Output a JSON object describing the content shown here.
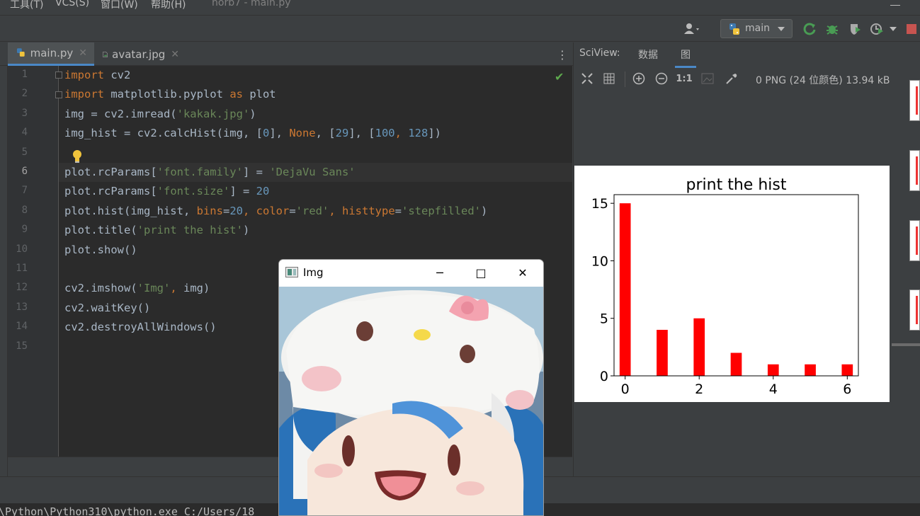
{
  "menubar": {
    "items": [
      "工具(T)",
      "VCS(S)",
      "窗口(W)",
      "帮助(H)"
    ],
    "title": "horb7 - main.py"
  },
  "toolbar": {
    "run_config": "main",
    "icons": [
      "user-icon",
      "python-icon",
      "rerun-icon",
      "debug-icon",
      "coverage-icon",
      "profile-icon",
      "stop-icon"
    ]
  },
  "editor": {
    "tabs": [
      {
        "label": "main.py",
        "icon": "python-file-icon",
        "active": true
      },
      {
        "label": "avatar.jpg",
        "icon": "image-file-icon",
        "active": false
      }
    ],
    "current_line": 6,
    "lines": [
      [
        [
          "kw",
          "import"
        ],
        [
          "pl",
          " cv2"
        ]
      ],
      [
        [
          "kw",
          "import"
        ],
        [
          "pl",
          " matplotlib.pyplot "
        ],
        [
          "kw",
          "as"
        ],
        [
          "pl",
          " plot"
        ]
      ],
      [
        [
          "pl",
          "img = cv2.imread("
        ],
        [
          "str",
          "'kakak.jpg'"
        ],
        [
          "pl",
          ")"
        ]
      ],
      [
        [
          "pl",
          "img_hist = cv2.calcHist(img, ["
        ],
        [
          "num",
          "0"
        ],
        [
          "pl",
          "], "
        ],
        [
          "kw",
          "None"
        ],
        [
          "pl",
          ", ["
        ],
        [
          "num",
          "29"
        ],
        [
          "pl",
          "], ["
        ],
        [
          "num",
          "100"
        ],
        [
          "kw",
          ", "
        ],
        [
          "num",
          "128"
        ],
        [
          "pl",
          "])"
        ]
      ],
      [],
      [
        [
          "pl",
          "plot.rcParams["
        ],
        [
          "str",
          "'font.family'"
        ],
        [
          "pl",
          "] = "
        ],
        [
          "str",
          "'DejaVu Sans'"
        ]
      ],
      [
        [
          "pl",
          "plot.rcParams["
        ],
        [
          "str",
          "'font.size'"
        ],
        [
          "pl",
          "] = "
        ],
        [
          "num",
          "20"
        ]
      ],
      [
        [
          "pl",
          "plot.hist(img_hist, "
        ],
        [
          "kw",
          "bins"
        ],
        [
          "pl",
          "="
        ],
        [
          "num",
          "20"
        ],
        [
          "kw",
          ", "
        ],
        [
          "kw",
          "color"
        ],
        [
          "pl",
          "="
        ],
        [
          "str",
          "'red'"
        ],
        [
          "kw",
          ", "
        ],
        [
          "kw",
          "histtype"
        ],
        [
          "pl",
          "="
        ],
        [
          "str",
          "'stepfilled'"
        ],
        [
          "pl",
          ")"
        ]
      ],
      [
        [
          "pl",
          "plot.title("
        ],
        [
          "str",
          "'print the hist'"
        ],
        [
          "pl",
          ")"
        ]
      ],
      [
        [
          "pl",
          "plot.show()"
        ]
      ],
      [],
      [
        [
          "pl",
          "cv2.imshow("
        ],
        [
          "str",
          "'Img'"
        ],
        [
          "kw",
          ", "
        ],
        [
          "pl",
          "img)"
        ]
      ],
      [
        [
          "pl",
          "cv2.waitKey()"
        ]
      ],
      [
        [
          "pl",
          "cv2.destroyAllWindows()"
        ]
      ],
      []
    ],
    "line_numbers": [
      "1",
      "2",
      "3",
      "4",
      "5",
      "6",
      "7",
      "8",
      "9",
      "10",
      "11",
      "12",
      "13",
      "14",
      "15"
    ]
  },
  "sciview": {
    "title": "SciView:",
    "tabs": [
      "数据",
      "图"
    ],
    "active_tab": "图",
    "info": "0 PNG (24 位颜色) 13.94 kB",
    "zoom_label": "1:1"
  },
  "chart_data": {
    "type": "bar",
    "title": "print the hist",
    "x": [
      0,
      1,
      2,
      3,
      4,
      5,
      6
    ],
    "values": [
      15,
      4,
      5,
      2,
      1,
      1,
      1
    ],
    "xlim": [
      -0.3,
      6.3
    ],
    "ylim": [
      0,
      15.75
    ],
    "xticks": [
      "0",
      "2",
      "4",
      "6"
    ],
    "yticks": [
      "0",
      "5",
      "10",
      "15"
    ],
    "color": "#ff0000",
    "grid": false
  },
  "image_window": {
    "title": "Img",
    "minimize": "─",
    "maximize": "□",
    "close": "✕"
  },
  "console": {
    "text": "\\Python\\Python310\\python.exe C:/Users/18"
  }
}
